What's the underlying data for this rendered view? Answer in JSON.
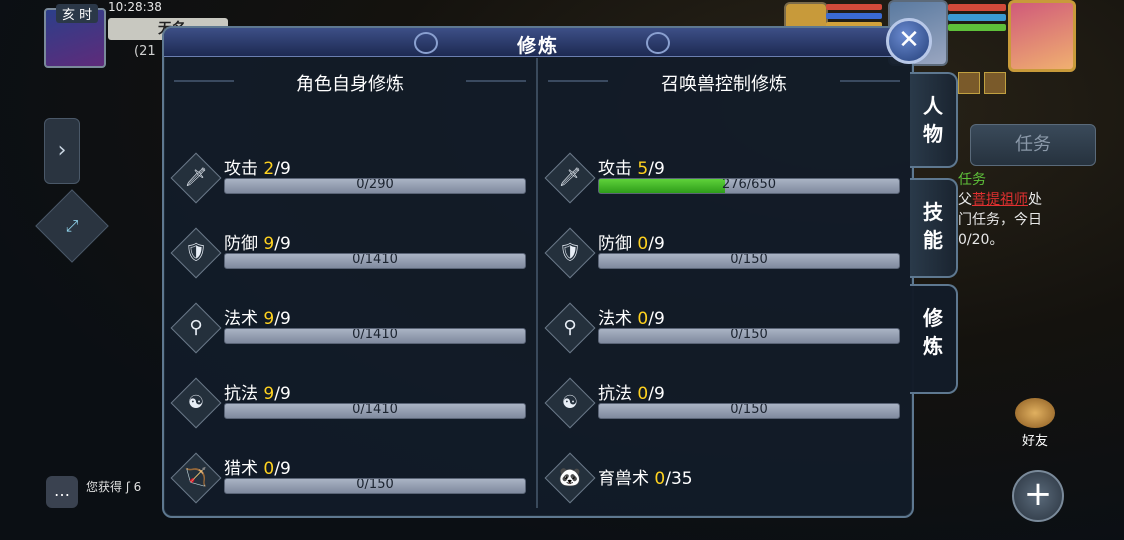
{
  "hud": {
    "time_tag": "亥 时",
    "clock": "10:28:38",
    "name": "无名",
    "level": "(21",
    "chat_text": "您获得 ʃ 6",
    "friends_label": "好友",
    "task_label": "任务",
    "task_frag": [
      {
        "text": "任务",
        "color": "#5ec03a"
      },
      {
        "text": "父",
        "color": "#e8e8e8"
      },
      {
        "text": "菩提祖师",
        "color": "#e03030"
      },
      {
        "text": "处",
        "color": "#e8e8e8"
      },
      {
        "text": "门任务，今日",
        "color": "#e8e8e8"
      },
      {
        "text": "0/20。",
        "color": "#e8e8e8"
      }
    ]
  },
  "dialog": {
    "title": "修炼",
    "close_glyph": "✕",
    "left": {
      "heading": "角色自身修炼",
      "rows": [
        {
          "icon": "attack-icon",
          "glyph": "🗡",
          "name": "攻击",
          "level": "2",
          "max": "/9",
          "progress": "0/290",
          "fill": 0
        },
        {
          "icon": "defense-icon",
          "glyph": "🛡",
          "name": "防御",
          "level": "9",
          "max": "/9",
          "progress": "0/1410",
          "fill": 0
        },
        {
          "icon": "magic-icon",
          "glyph": "⚲",
          "name": "法术",
          "level": "9",
          "max": "/9",
          "progress": "0/1410",
          "fill": 0
        },
        {
          "icon": "resist-icon",
          "glyph": "☯",
          "name": "抗法",
          "level": "9",
          "max": "/9",
          "progress": "0/1410",
          "fill": 0
        },
        {
          "icon": "hunting-icon",
          "glyph": "🏹",
          "name": "猎术",
          "level": "0",
          "max": "/9",
          "progress": "0/150",
          "fill": 0
        }
      ]
    },
    "right": {
      "heading": "召唤兽控制修炼",
      "rows": [
        {
          "icon": "attack-icon",
          "glyph": "🗡",
          "name": "攻击",
          "level": "5",
          "max": "/9",
          "progress": "276/650",
          "fill": 0.42
        },
        {
          "icon": "defense-icon",
          "glyph": "🛡",
          "name": "防御",
          "level": "0",
          "max": "/9",
          "progress": "0/150",
          "fill": 0
        },
        {
          "icon": "magic-icon",
          "glyph": "⚲",
          "name": "法术",
          "level": "0",
          "max": "/9",
          "progress": "0/150",
          "fill": 0
        },
        {
          "icon": "resist-icon",
          "glyph": "☯",
          "name": "抗法",
          "level": "0",
          "max": "/9",
          "progress": "0/150",
          "fill": 0
        }
      ],
      "beast_skill": {
        "icon": "beast-taming-icon",
        "glyph": "🐼",
        "name": "育兽术",
        "level": "0",
        "max": "/35"
      }
    }
  },
  "tabs": [
    {
      "id": "character",
      "label": "人\n物",
      "active": false
    },
    {
      "id": "skills",
      "label": "技\n能",
      "active": false
    },
    {
      "id": "cultivation",
      "label": "修\n炼",
      "active": true
    }
  ]
}
